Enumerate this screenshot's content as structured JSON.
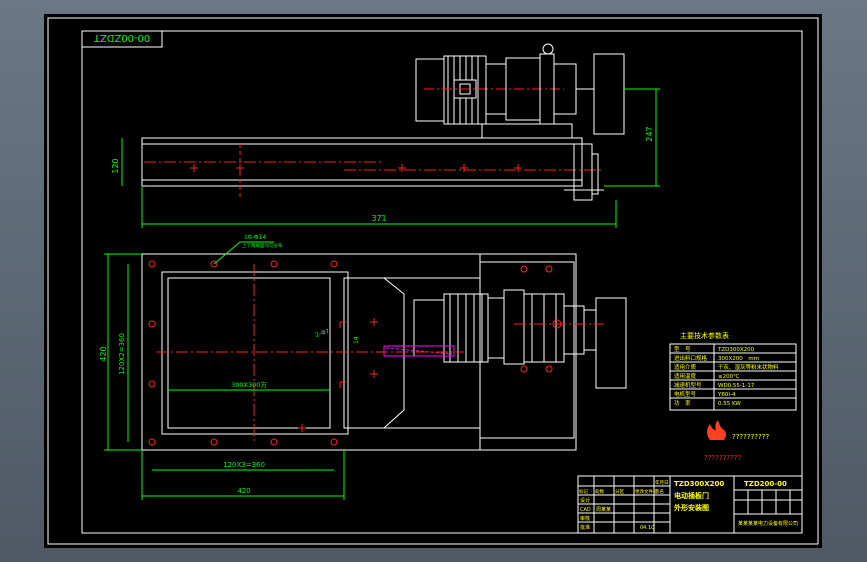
{
  "drawing": {
    "title_block_code_rotated": "00-00ZDZT",
    "main_title_line1": "TZD300X200",
    "main_title_line2": "电动插板门",
    "main_title_line3": "外形安装图",
    "drawing_code": "TZD200-00",
    "company": "某某某某电力设备有限公司",
    "sign_rows": [
      "设计",
      "CAD",
      "审核",
      "批准"
    ],
    "sign_values": [
      "",
      "周某某",
      "",
      "04.10"
    ],
    "tb_header_cells": [
      "标记",
      "处数",
      "分区",
      "更改文件号",
      "签名",
      "年月日"
    ],
    "logo_text": "??????????",
    "logo_sub": "??????????"
  },
  "dimensions": {
    "top_height": "120",
    "top_length": "371",
    "top_right": "247",
    "hole_note": "10-Φ14",
    "hole_note2": "上下两端面均匀分布",
    "left_outer": "420",
    "left_inner": "120X2=360",
    "bottom_inner": "120X3=360",
    "bottom_outer": "420",
    "opening": "300X300方",
    "rod": "2-Φ7",
    "rod_w": "14"
  },
  "params": {
    "title": "主要技术参数表",
    "rows": [
      [
        "型　号",
        "TZD300X200"
      ],
      [
        "进出料口规格",
        "300X200　mm"
      ],
      [
        "适用介质",
        "干灰、湿灰等粉末状物料"
      ],
      [
        "适用温度",
        "≤200℃"
      ],
      [
        "减速机型号",
        "WD0.55-1-17"
      ],
      [
        "电机型号",
        "Y80I-4"
      ],
      [
        "功　率",
        "0.55 KW"
      ]
    ]
  },
  "colors": {
    "line": "#ffffff",
    "yellow": "#ffff00",
    "red": "#ff2020",
    "green": "#00ff00",
    "magenta": "#ff00ff",
    "cyan": "#00ffff"
  }
}
